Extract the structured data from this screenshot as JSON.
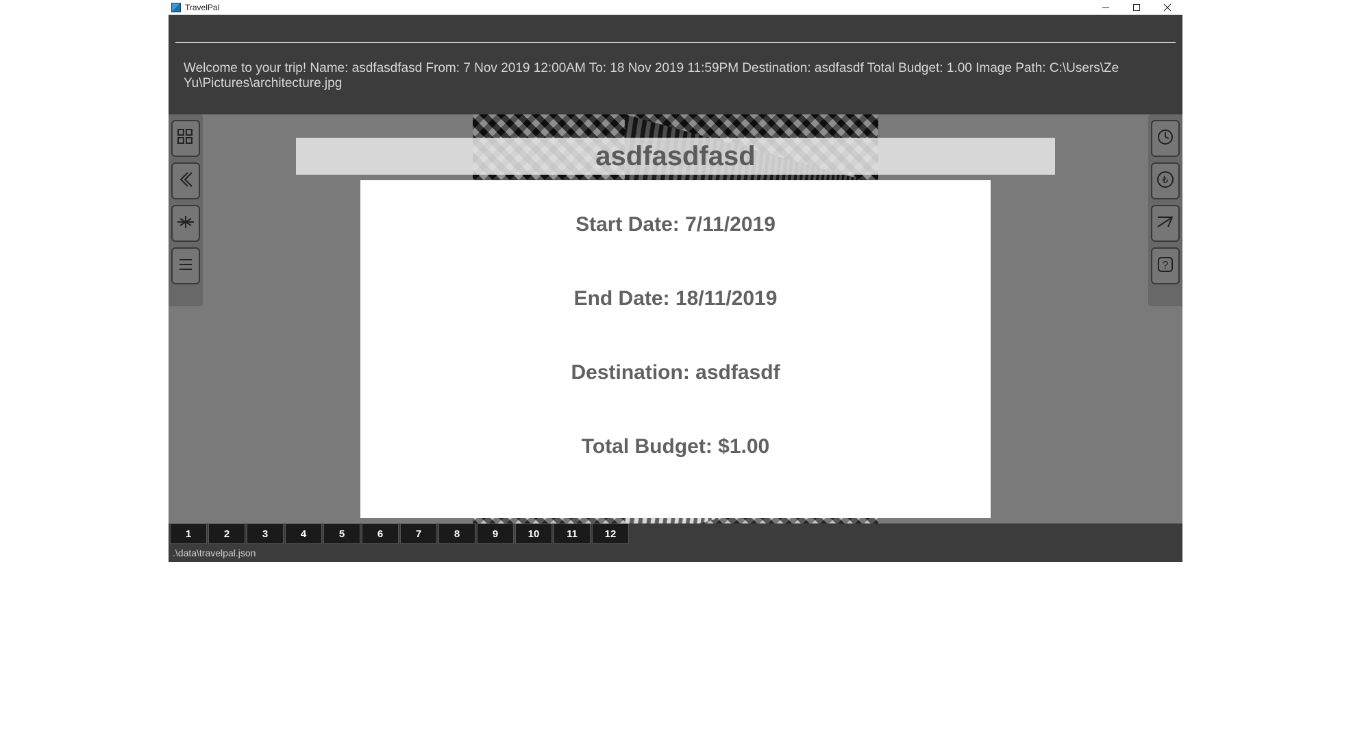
{
  "window": {
    "title": "TravelPal"
  },
  "command_input": {
    "value": "",
    "placeholder": ""
  },
  "message": "Welcome to your trip! Name: asdfasdfasd From: 7 Nov 2019 12:00AM To: 18 Nov 2019 11:59PM Destination: asdfasdf Total Budget: 1.00 Image Path: C:\\Users\\Ze Yu\\Pictures\\architecture.jpg",
  "trip": {
    "title": "asdfasdfasd",
    "details": {
      "start_date": {
        "label": "Start Date:",
        "value": "7/11/2019"
      },
      "end_date": {
        "label": "End Date:",
        "value": "18/11/2019"
      },
      "destination": {
        "label": "Destination:",
        "value": "asdfasdf"
      },
      "budget": {
        "label": "Total Budget:",
        "value": "$1.00"
      }
    }
  },
  "left_rail": [
    {
      "name": "grid-icon"
    },
    {
      "name": "back-icon"
    },
    {
      "name": "plane-icon"
    },
    {
      "name": "list-icon"
    }
  ],
  "right_rail": [
    {
      "name": "clock-icon"
    },
    {
      "name": "currency-icon"
    },
    {
      "name": "plane2-icon"
    },
    {
      "name": "help-icon"
    }
  ],
  "day_tabs": [
    "1",
    "2",
    "3",
    "4",
    "5",
    "6",
    "7",
    "8",
    "9",
    "10",
    "11",
    "12"
  ],
  "status": ".\\data\\travelpal.json"
}
